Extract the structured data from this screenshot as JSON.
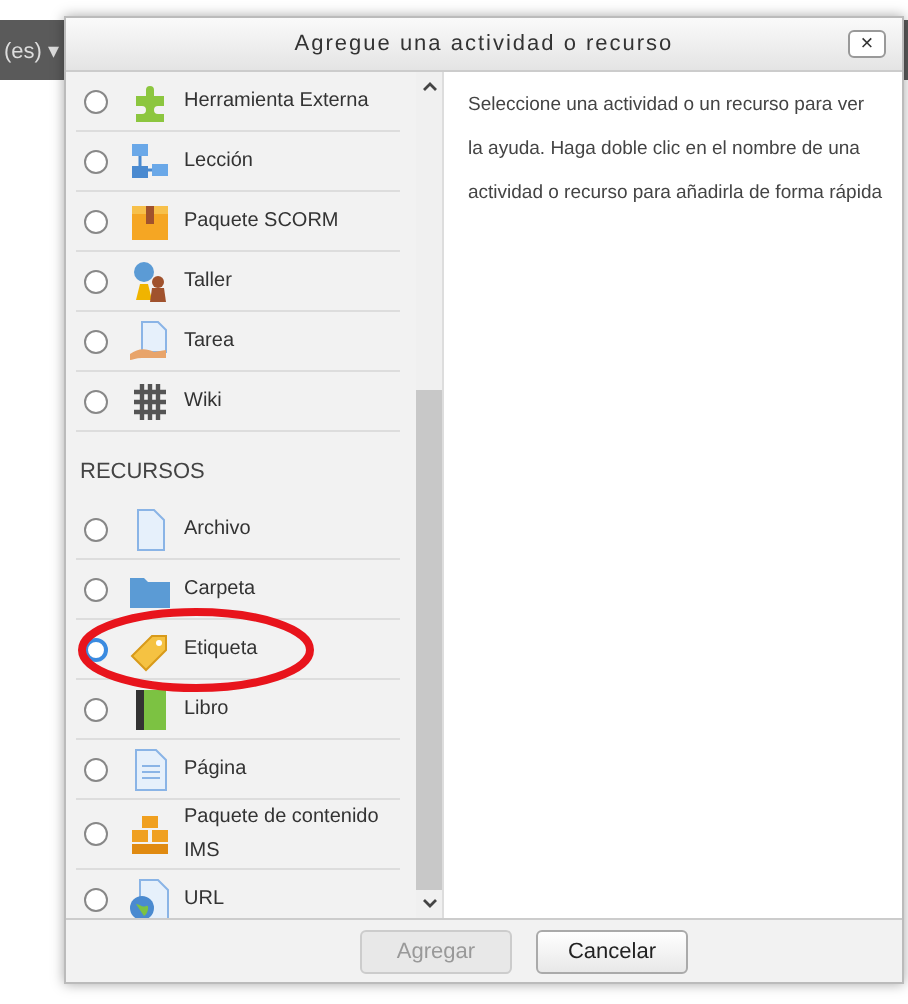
{
  "background": {
    "language_menu": "(es) ▾"
  },
  "dialog": {
    "title": "Agregue una actividad o recurso",
    "close": "×",
    "sections": [
      {
        "items": [
          {
            "label": "Herramienta Externa",
            "selected": false
          },
          {
            "label": "Lección",
            "selected": false
          },
          {
            "label": "Paquete SCORM",
            "selected": false
          },
          {
            "label": "Taller",
            "selected": false
          },
          {
            "label": "Tarea",
            "selected": false
          },
          {
            "label": "Wiki",
            "selected": false
          }
        ]
      },
      {
        "heading": "RECURSOS",
        "items": [
          {
            "label": "Archivo",
            "selected": false
          },
          {
            "label": "Carpeta",
            "selected": false
          },
          {
            "label": "Etiqueta",
            "selected": true
          },
          {
            "label": "Libro",
            "selected": false
          },
          {
            "label": "Página",
            "selected": false
          },
          {
            "label": "Paquete de contenido IMS",
            "selected": false
          },
          {
            "label": "URL",
            "selected": false
          }
        ]
      }
    ],
    "help": "Seleccione una actividad o un recurso para ver la ayuda. Haga doble clic en el nombre de una actividad o recurso para añadirla de forma rápida",
    "buttons": [
      {
        "label": "Agregar",
        "disabled": true
      },
      {
        "label": "Cancelar",
        "disabled": false
      }
    ]
  }
}
